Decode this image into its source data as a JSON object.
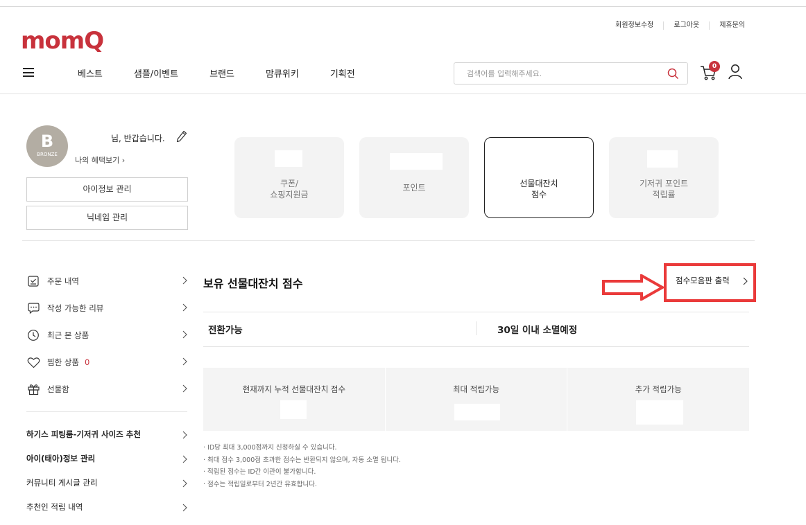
{
  "header": {
    "logo": "momQ",
    "util_links": [
      "회원정보수정",
      "로그아웃",
      "제휴문의"
    ],
    "nav": [
      "베스트",
      "샘플/이벤트",
      "브랜드",
      "맘큐위키",
      "기획전"
    ],
    "search_placeholder": "검색어를 입력해주세요.",
    "cart_count": "0"
  },
  "profile": {
    "grade_letter": "B",
    "grade_name": "BRONZE",
    "greeting": "님, 반갑습니다.",
    "benefit_link": "나의 혜택보기",
    "buttons": [
      "아이정보 관리",
      "닉네임 관리"
    ]
  },
  "cards": [
    {
      "label": "쿠폰/\n쇼핑지원금",
      "active": false
    },
    {
      "label": "포인트",
      "active": false
    },
    {
      "label": "선물대잔치\n점수",
      "active": true
    },
    {
      "label": "기저귀 포인트\n적립률",
      "active": false
    }
  ],
  "sidemenu": {
    "items": [
      {
        "label": "주문 내역",
        "icon": "order-icon"
      },
      {
        "label": "작성 가능한 리뷰",
        "icon": "review-icon"
      },
      {
        "label": "최근 본 상품",
        "icon": "clock-icon"
      },
      {
        "label": "찜한 상품",
        "icon": "heart-icon",
        "count": "0"
      },
      {
        "label": "선물함",
        "icon": "gift-icon"
      }
    ],
    "links": [
      {
        "label": "하기스 피팅룸-기저귀 사이즈 추천",
        "bold": true
      },
      {
        "label": "아이(태아)정보 관리",
        "bold": true
      },
      {
        "label": "커뮤니티 게시글 관리",
        "bold": false
      },
      {
        "label": "추천인 적립 내역",
        "bold": false
      }
    ]
  },
  "main": {
    "title": "보유 선물대잔치 점수",
    "print_link": "점수모음판 출력",
    "tab_convertible": "전환가능",
    "tab_expiring": "30일 이내 소멸예정",
    "score_labels": [
      "현재까지 누적 선물대잔치 점수",
      "최대 적립가능",
      "추가 적립가능"
    ],
    "notes": [
      "· ID당 최대 3,000점까지 신청하실 수 있습니다.",
      "· 최대 점수 3,000점 초과한 점수는 반환되지 않으며, 자동 소멸 됩니다.",
      "· 적립된 점수는 ID간 이관이 불가합니다.",
      "· 점수는 적립일로부터 2년간 유효합니다."
    ]
  },
  "colors": {
    "brand": "#c8323c",
    "annotation_red": "#ea3a3a",
    "card_bg": "#f3f3f3",
    "avatar_bg": "#b3ada3"
  }
}
